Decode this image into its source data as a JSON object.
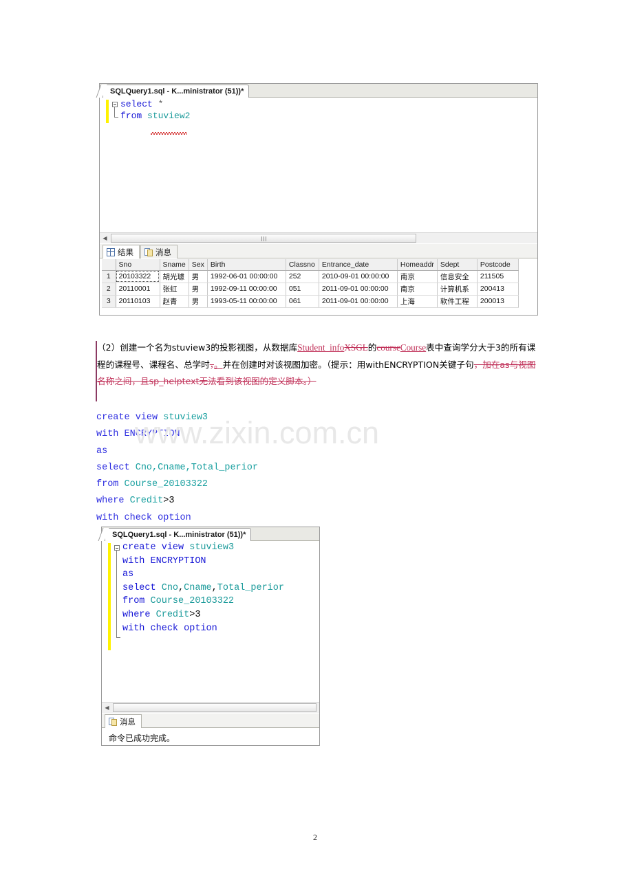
{
  "document": {
    "page_number": "2",
    "watermark": "www.zixin.com.cn",
    "paragraph": {
      "seg1": "（2）创建一个名为stuview3的投影视图，从数据库",
      "ins_student_info": "Student_info",
      "del_xsgl": "XSGL",
      "seg2": "的",
      "del_course": "course",
      "ins_course": "Course",
      "seg3": "表中查询学分大于3的所有课程的课程号、课程名、总学时",
      "del_comma": "，",
      "ins_period": "。",
      "seg4": "并在创建时对该视图加密。（提示：用withENCRYPTION关键子句",
      "del_tail": "，加在as与视图名称之间，且sp_helptext无法看到该视图的定义脚本。）"
    },
    "code_block": {
      "lines": [
        [
          {
            "t": "create view ",
            "c": "k"
          },
          {
            "t": "stuview3",
            "c": "i"
          }
        ],
        [
          {
            "t": "with ",
            "c": "k"
          },
          {
            "t": "ENCRYPTION",
            "c": "k"
          }
        ],
        [
          {
            "t": "as",
            "c": "k"
          }
        ],
        [
          {
            "t": "select ",
            "c": "k"
          },
          {
            "t": "Cno,Cname,Total_perior",
            "c": "i"
          }
        ],
        [
          {
            "t": "from ",
            "c": "k"
          },
          {
            "t": "Course_20103322",
            "c": "i"
          }
        ],
        [
          {
            "t": "where ",
            "c": "k"
          },
          {
            "t": "Credit",
            "c": "i"
          },
          {
            "t": ">3",
            "c": "n"
          }
        ],
        [
          {
            "t": "with check option",
            "c": "k"
          }
        ]
      ]
    }
  },
  "ssms_window_1": {
    "tab_title": "SQLQuery1.sql - K...ministrator (51))*",
    "editor_lines": [
      [
        {
          "t": "select",
          "c": "kw"
        },
        {
          "t": " ",
          "c": "op"
        },
        {
          "t": "*",
          "c": "star"
        }
      ],
      [
        {
          "t": "from",
          "c": "kw"
        },
        {
          "t": " ",
          "c": "op"
        },
        {
          "t": "stuview2",
          "c": "id"
        }
      ]
    ],
    "result_tabs": [
      {
        "label": "结果",
        "icon": "grid-icon",
        "active": true
      },
      {
        "label": "消息",
        "icon": "message-icon",
        "active": false
      }
    ],
    "grid": {
      "columns": [
        "Sno",
        "Sname",
        "Sex",
        "Birth",
        "Classno",
        "Entrance_date",
        "Homeaddr",
        "Sdept",
        "Postcode"
      ],
      "rows": [
        {
          "n": "1",
          "cells": [
            "20103322",
            "胡光璩",
            "男",
            "1992-06-01 00:00:00",
            "252",
            "2010-09-01 00:00:00",
            "南京",
            "信息安全",
            "211505"
          ]
        },
        {
          "n": "2",
          "cells": [
            "20110001",
            "张虹",
            "男",
            "1992-09-11 00:00:00",
            "051",
            "2011-09-01 00:00:00",
            "南京",
            "计算机系",
            "200413"
          ]
        },
        {
          "n": "3",
          "cells": [
            "20110103",
            "赵青",
            "男",
            "1993-05-11 00:00:00",
            "061",
            "2011-09-01 00:00:00",
            "上海",
            "软件工程",
            "200013"
          ]
        }
      ]
    }
  },
  "ssms_window_2": {
    "tab_title": "SQLQuery1.sql - K...ministrator (51))*",
    "editor_lines": [
      [
        {
          "t": "create",
          "c": "kw"
        },
        {
          "t": " ",
          "c": "op"
        },
        {
          "t": "view",
          "c": "kw"
        },
        {
          "t": " ",
          "c": "op"
        },
        {
          "t": "stuview3",
          "c": "id"
        }
      ],
      [
        {
          "t": "with",
          "c": "kw"
        },
        {
          "t": " ",
          "c": "op"
        },
        {
          "t": "ENCRYPTION",
          "c": "kw"
        }
      ],
      [
        {
          "t": "as",
          "c": "kw"
        }
      ],
      [
        {
          "t": "select",
          "c": "kw"
        },
        {
          "t": " ",
          "c": "op"
        },
        {
          "t": "Cno",
          "c": "id"
        },
        {
          "t": ",",
          "c": "op"
        },
        {
          "t": "Cname",
          "c": "id"
        },
        {
          "t": ",",
          "c": "op"
        },
        {
          "t": "Total_perior",
          "c": "id"
        }
      ],
      [
        {
          "t": "from",
          "c": "kw"
        },
        {
          "t": " ",
          "c": "op"
        },
        {
          "t": "Course_20103322",
          "c": "id"
        }
      ],
      [
        {
          "t": "where",
          "c": "kw"
        },
        {
          "t": " ",
          "c": "op"
        },
        {
          "t": "Credit",
          "c": "id"
        },
        {
          "t": ">3",
          "c": "num"
        }
      ],
      [
        {
          "t": "with",
          "c": "kw"
        },
        {
          "t": " ",
          "c": "op"
        },
        {
          "t": "check",
          "c": "kw"
        },
        {
          "t": " ",
          "c": "op"
        },
        {
          "t": "option",
          "c": "kw"
        }
      ]
    ],
    "result_tabs": [
      {
        "label": "消息",
        "icon": "message-icon",
        "active": true
      }
    ],
    "message_text": "命令已成功完成。"
  },
  "colors": {
    "keyword": "#1515d6",
    "identifier": "#1a9a9a",
    "tracked_change": "#c03058",
    "gutter_yellow": "#fff200"
  }
}
